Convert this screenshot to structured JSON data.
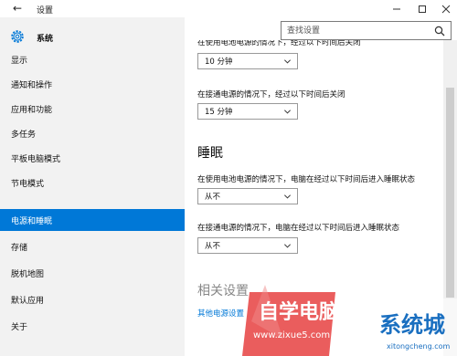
{
  "window": {
    "title": "设置",
    "back_icon": "back-arrow-icon",
    "controls": [
      "minimize-icon",
      "maximize-icon",
      "close-icon"
    ]
  },
  "sidebar": {
    "header": "系统",
    "header_icon": "gear-icon",
    "items": [
      {
        "label": "显示"
      },
      {
        "label": "通知和操作"
      },
      {
        "label": "应用和功能"
      },
      {
        "label": "多任务"
      },
      {
        "label": "平板电脑模式"
      },
      {
        "label": "节电模式"
      },
      {
        "label": "电源和睡眠",
        "active": true
      },
      {
        "label": "存储"
      },
      {
        "label": "脱机地图"
      },
      {
        "label": "默认应用"
      },
      {
        "label": "关于"
      }
    ]
  },
  "search": {
    "placeholder": "查找设置",
    "icon": "search-icon"
  },
  "screen": {
    "battery_label_partial": "在使用电池电源的情况下，经过以下时间后关闭",
    "battery_value": "10 分钟",
    "plugged_label": "在接通电源的情况下，经过以下时间后关闭",
    "plugged_value": "15 分钟"
  },
  "sleep": {
    "title": "睡眠",
    "battery_label": "在使用电池电源的情况下，电脑在经过以下时间后进入睡眠状态",
    "battery_value": "从不",
    "plugged_label": "在接通电源的情况下，电脑在经过以下时间后进入睡眠状态",
    "plugged_value": "从不"
  },
  "related": {
    "title": "相关设置",
    "link": "其他电源设置"
  },
  "watermark": {
    "line1": "自学电脑网",
    "line2": "www.zixue5.com",
    "line3": "系统城",
    "line4": "xitongcheng.com"
  },
  "colors": {
    "accent": "#0078d7",
    "sidebar_bg": "#f2f2f2"
  }
}
